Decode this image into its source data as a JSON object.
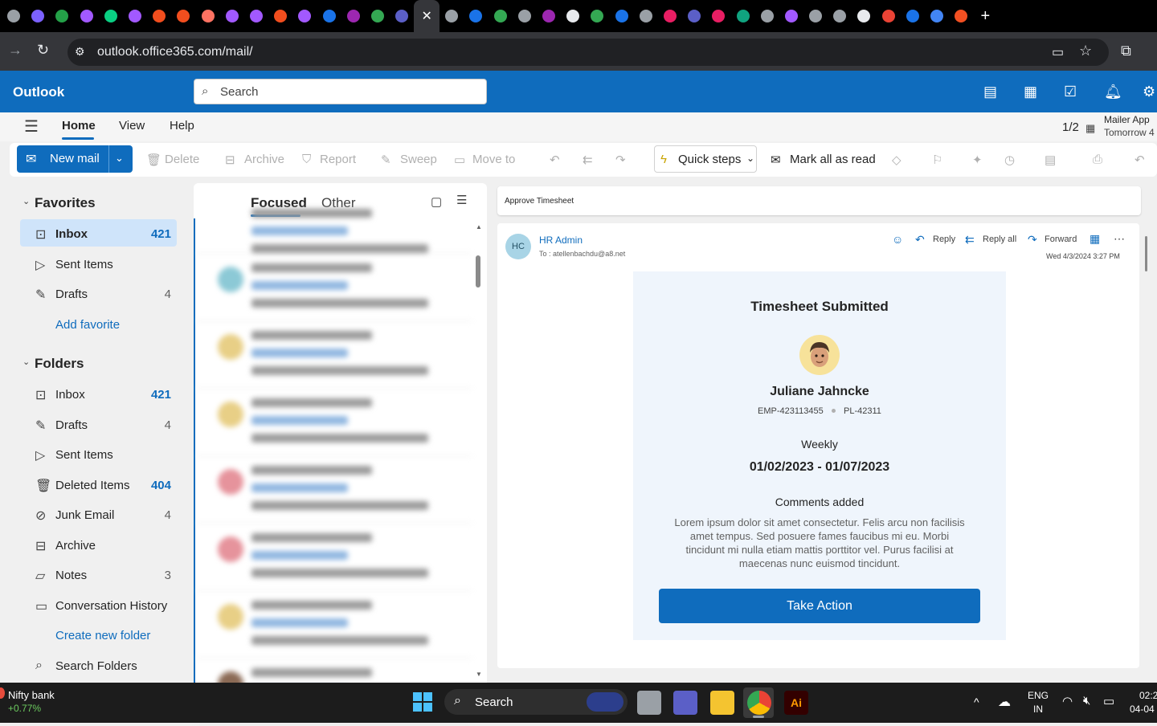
{
  "browser": {
    "url": "outlook.office365.com/mail/",
    "active_tab_close": "✕",
    "new_tab": "+",
    "tab_icon_colors": [
      "#9aa0a6",
      "#7b61ff",
      "#24a148",
      "#a259ff",
      "#0acf83",
      "#a259ff",
      "#f24e1e",
      "#f24e1e",
      "#ff7262",
      "#a259ff",
      "#a259ff",
      "#f24e1e",
      "#a259ff",
      "#1a73e8",
      "#9c27b0",
      "#34a853",
      "#5b5fc7",
      "#9aa0a6",
      "#1a73e8",
      "#34a853",
      "#9aa0a6",
      "#9c27b0",
      "#e8eaed",
      "#34a853",
      "#1a73e8",
      "#9aa0a6",
      "#e91e63",
      "#5b5fc7",
      "#e91e63",
      "#10a37f",
      "#9aa0a6",
      "#a259ff",
      "#9aa0a6",
      "#9aa0a6",
      "#e8eaed",
      "#ea4335",
      "#1a73e8",
      "#4285f4",
      "#f25022"
    ]
  },
  "outlook": {
    "brand": "Outlook",
    "search_placeholder": "Search",
    "menu_tabs": [
      "Home",
      "View",
      "Help"
    ],
    "page_counter": "1/2",
    "mailer_app_title": "Mailer App",
    "mailer_app_sub": "Tomorrow 4",
    "ribbon": {
      "new_mail": "New mail",
      "delete": "Delete",
      "archive": "Archive",
      "report": "Report",
      "sweep": "Sweep",
      "move_to": "Move to",
      "quick_steps": "Quick steps",
      "mark_all_read": "Mark all as read"
    }
  },
  "nav": {
    "favorites_header": "Favorites",
    "folders_header": "Folders",
    "favorites": [
      {
        "label": "Inbox",
        "count": "421",
        "icon": "inbox-icon",
        "selected": true
      },
      {
        "label": "Sent Items",
        "count": "",
        "icon": "send-icon"
      },
      {
        "label": "Drafts",
        "count": "4",
        "icon": "pencil-icon"
      }
    ],
    "add_favorite": "Add favorite",
    "folders": [
      {
        "label": "Inbox",
        "count": "421",
        "icon": "inbox-icon"
      },
      {
        "label": "Drafts",
        "count": "4",
        "icon": "pencil-icon"
      },
      {
        "label": "Sent Items",
        "count": "",
        "icon": "send-icon"
      },
      {
        "label": "Deleted Items",
        "count": "404",
        "icon": "trash-icon"
      },
      {
        "label": "Junk Email",
        "count": "4",
        "icon": "junk-icon"
      },
      {
        "label": "Archive",
        "count": "",
        "icon": "archive-icon"
      },
      {
        "label": "Notes",
        "count": "3",
        "icon": "note-icon"
      },
      {
        "label": "Conversation History",
        "count": "",
        "icon": "folder-icon"
      }
    ],
    "create_folder": "Create new folder",
    "search_folders": "Search Folders"
  },
  "message_list": {
    "tabs": [
      "Focused",
      "Other"
    ],
    "avatar_colors": [
      "#8cc9d6",
      "#e8cf86",
      "#e8cf86",
      "#e6939c",
      "#e6939c",
      "#e8cf86",
      "#8b6a55"
    ]
  },
  "reading_pane": {
    "subject": "Approve Timesheet",
    "sender_initials": "HC",
    "sender": "HR Admin",
    "to": "To : atellenbachdu@a8.net",
    "date": "Wed 4/3/2024 3:27 PM",
    "actions": [
      "Reply",
      "Reply all",
      "Forward"
    ],
    "card": {
      "title": "Timesheet Submitted",
      "name": "Juliane Jahncke",
      "emp_id": "EMP-423113455",
      "project_id": "PL-42311",
      "period_type": "Weekly",
      "period": "01/02/2023 - 01/07/2023",
      "comments_header": "Comments added",
      "comments": "Lorem ipsum dolor sit amet consectetur. Felis arcu non facilisis amet tempus. Sed posuere fames faucibus mi eu. Morbi tincidunt mi nulla etiam mattis porttitor vel. Purus facilisi at maecenas nunc euismod tincidunt.",
      "cta": "Take Action"
    }
  },
  "taskbar": {
    "stock_name": "Nifty bank",
    "stock_change": "+0.77%",
    "search": "Search",
    "lang": "ENG",
    "region": "IN",
    "time": "02:2",
    "date": "04-04"
  }
}
